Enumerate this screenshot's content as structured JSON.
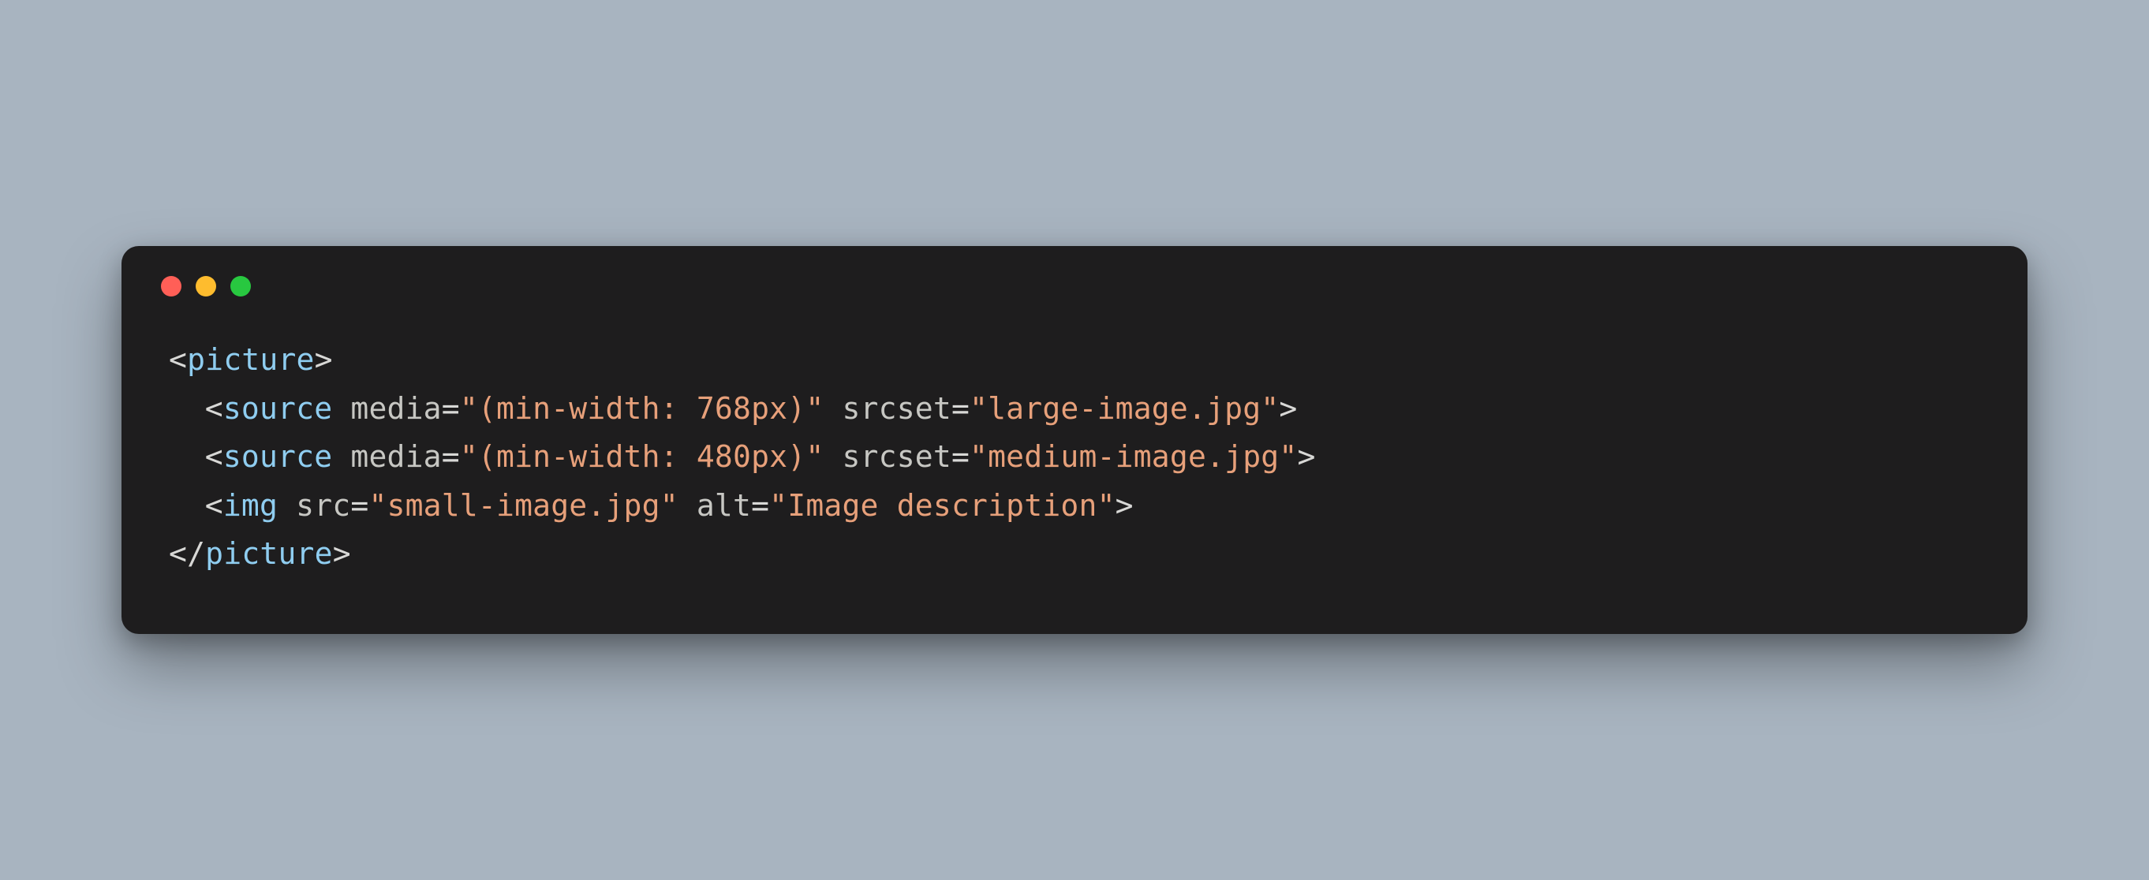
{
  "window": {
    "traffic_lights": [
      "close",
      "minimize",
      "maximize"
    ]
  },
  "code": {
    "language": "html",
    "lines": [
      {
        "indent": 0,
        "tokens": [
          {
            "t": "punct",
            "v": "<"
          },
          {
            "t": "tag",
            "v": "picture"
          },
          {
            "t": "punct",
            "v": ">"
          }
        ]
      },
      {
        "indent": 1,
        "tokens": [
          {
            "t": "punct",
            "v": "<"
          },
          {
            "t": "tag",
            "v": "source"
          },
          {
            "t": "punct",
            "v": " "
          },
          {
            "t": "attr",
            "v": "media"
          },
          {
            "t": "punct",
            "v": "="
          },
          {
            "t": "str",
            "v": "\"(min-width: 768px)\""
          },
          {
            "t": "punct",
            "v": " "
          },
          {
            "t": "attr",
            "v": "srcset"
          },
          {
            "t": "punct",
            "v": "="
          },
          {
            "t": "str",
            "v": "\"large-image.jpg\""
          },
          {
            "t": "punct",
            "v": ">"
          }
        ]
      },
      {
        "indent": 1,
        "tokens": [
          {
            "t": "punct",
            "v": "<"
          },
          {
            "t": "tag",
            "v": "source"
          },
          {
            "t": "punct",
            "v": " "
          },
          {
            "t": "attr",
            "v": "media"
          },
          {
            "t": "punct",
            "v": "="
          },
          {
            "t": "str",
            "v": "\"(min-width: 480px)\""
          },
          {
            "t": "punct",
            "v": " "
          },
          {
            "t": "attr",
            "v": "srcset"
          },
          {
            "t": "punct",
            "v": "="
          },
          {
            "t": "str",
            "v": "\"medium-image.jpg\""
          },
          {
            "t": "punct",
            "v": ">"
          }
        ]
      },
      {
        "indent": 1,
        "tokens": [
          {
            "t": "punct",
            "v": "<"
          },
          {
            "t": "tag",
            "v": "img"
          },
          {
            "t": "punct",
            "v": " "
          },
          {
            "t": "attr",
            "v": "src"
          },
          {
            "t": "punct",
            "v": "="
          },
          {
            "t": "str",
            "v": "\"small-image.jpg\""
          },
          {
            "t": "punct",
            "v": " "
          },
          {
            "t": "attr",
            "v": "alt"
          },
          {
            "t": "punct",
            "v": "="
          },
          {
            "t": "str",
            "v": "\"Image description\""
          },
          {
            "t": "punct",
            "v": ">"
          }
        ]
      },
      {
        "indent": 0,
        "tokens": [
          {
            "t": "punct",
            "v": "</"
          },
          {
            "t": "tag",
            "v": "picture"
          },
          {
            "t": "punct",
            "v": ">"
          }
        ]
      }
    ]
  }
}
